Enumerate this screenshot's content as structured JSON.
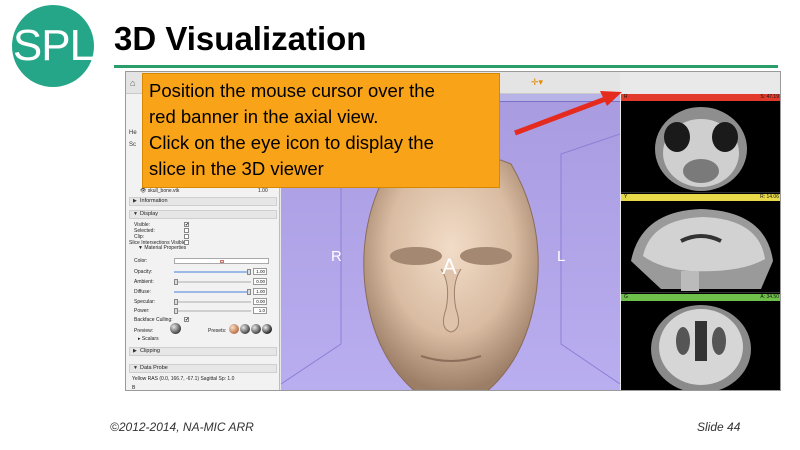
{
  "slide": {
    "logo_text": "SPL",
    "title": "3D Visualization",
    "footer_left": "©2012-2014, NA-MIC ARR",
    "footer_right": "Slide 44"
  },
  "callout": {
    "lines": [
      "Position the mouse cursor over the",
      "red banner in the axial view.",
      "Click on the eye icon to display the",
      "slice in the 3D viewer"
    ]
  },
  "panel": {
    "side_tabs": [
      "He",
      "Sc"
    ],
    "model_row": "skull_bone.vtk",
    "model_value": "1.00",
    "sections": {
      "information": "Information",
      "display": "Display",
      "material": "Material Properties",
      "scalars": "Scalars",
      "clipping": "Clipping",
      "data_probe": "Data Probe"
    },
    "display_fields": [
      {
        "label": "Visible:",
        "checked": "✔"
      },
      {
        "label": "Selected:",
        "checked": ""
      },
      {
        "label": "Clip:",
        "checked": ""
      },
      {
        "label": "Slice Intersections Visible:",
        "checked": ""
      }
    ],
    "material": {
      "color_label": "Color:",
      "sliders": [
        {
          "label": "Opacity:",
          "value": "1.00",
          "fraction": 1.0
        },
        {
          "label": "Ambient:",
          "value": "0.00",
          "fraction": 0.0
        },
        {
          "label": "Diffuse:",
          "value": "1.00",
          "fraction": 1.0
        },
        {
          "label": "Specular:",
          "value": "0.00",
          "fraction": 0.0
        },
        {
          "label": "Power:",
          "value": "1.0",
          "fraction": 0.0
        }
      ],
      "backface_label": "Backface Culling:",
      "backface_checked": "✔",
      "preview_label": "Preview:",
      "presets_label": "Presets:"
    },
    "probe_text": "Yellow  RAS (0.0, 166.7, -67.1)  Sagittal  Sp: 1.0",
    "probe_next": "B"
  },
  "view3d": {
    "orient_left": "R",
    "orient_right": "L",
    "orient_front": "A"
  },
  "slices": [
    {
      "id": "axial",
      "label": "R",
      "value": "S: 47.19",
      "color": "#e33b2b"
    },
    {
      "id": "sagittal",
      "label": "Y",
      "value": "R: 14.06",
      "color": "#e7d94a"
    },
    {
      "id": "coronal",
      "label": "G",
      "value": "A: 34.50",
      "color": "#6ec04a"
    }
  ],
  "colors": {
    "logo": "#26a688",
    "rule": "#2a9d6a",
    "callout": "#f8a318",
    "arrow": "#e52b1e",
    "view3d_bg": "#b0a4ea"
  }
}
